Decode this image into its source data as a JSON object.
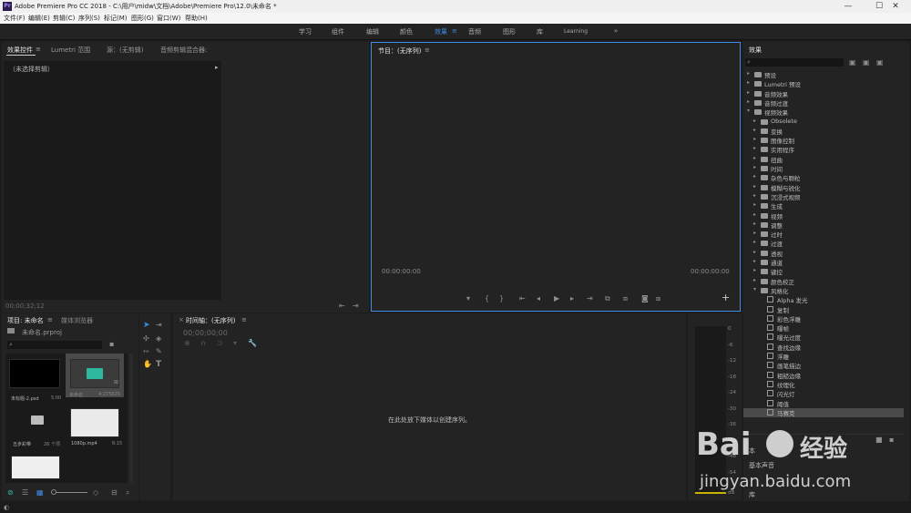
{
  "title": {
    "text": "Adobe Premiere Pro CC 2018 - C:\\用户\\midw\\文档\\Adobe\\Premiere Pro\\12.0\\未命名 *",
    "logo": "Pr",
    "minimize": "—",
    "maximize": "☐",
    "close": "✕"
  },
  "menu": [
    "文件(F)",
    "编辑(E)",
    "剪辑(C)",
    "序列(S)",
    "标记(M)",
    "图形(G)",
    "窗口(W)",
    "帮助(H)"
  ],
  "workspaces": {
    "items": [
      "学习",
      "组件",
      "编辑",
      "颜色",
      "效果",
      "音频",
      "图形",
      "库",
      "Learning"
    ],
    "active": "效果",
    "more": "»"
  },
  "source_panel": {
    "tabs": [
      "效果控件",
      "Lumetri 范围",
      "源：(无剪辑)",
      "音频剪辑混合器:"
    ],
    "no_clip": "（未选择剪辑）",
    "timecode": "00;00;32;12"
  },
  "program_panel": {
    "title": "节目：(无序列)",
    "timecode_left": "00:00:00:00",
    "timecode_right": "00:00:00:00"
  },
  "effects_panel": {
    "title": "效果",
    "tree": [
      {
        "label": "预设",
        "level": 0,
        "type": "folder",
        "expanded": false
      },
      {
        "label": "Lumetri 预设",
        "level": 0,
        "type": "folder",
        "expanded": false
      },
      {
        "label": "音频效果",
        "level": 0,
        "type": "folder",
        "expanded": false
      },
      {
        "label": "音频过渡",
        "level": 0,
        "type": "folder",
        "expanded": false
      },
      {
        "label": "视频效果",
        "level": 0,
        "type": "folder",
        "expanded": true
      },
      {
        "label": "Obsolete",
        "level": 1,
        "type": "folder",
        "expanded": false
      },
      {
        "label": "变换",
        "level": 1,
        "type": "folder",
        "expanded": false
      },
      {
        "label": "图像控制",
        "level": 1,
        "type": "folder",
        "expanded": false
      },
      {
        "label": "实用程序",
        "level": 1,
        "type": "folder",
        "expanded": false
      },
      {
        "label": "扭曲",
        "level": 1,
        "type": "folder",
        "expanded": false
      },
      {
        "label": "时间",
        "level": 1,
        "type": "folder",
        "expanded": false
      },
      {
        "label": "杂色与颗粒",
        "level": 1,
        "type": "folder",
        "expanded": false
      },
      {
        "label": "模糊与锐化",
        "level": 1,
        "type": "folder",
        "expanded": false
      },
      {
        "label": "沉浸式视频",
        "level": 1,
        "type": "folder",
        "expanded": false
      },
      {
        "label": "生成",
        "level": 1,
        "type": "folder",
        "expanded": false
      },
      {
        "label": "视频",
        "level": 1,
        "type": "folder",
        "expanded": false
      },
      {
        "label": "调整",
        "level": 1,
        "type": "folder",
        "expanded": false
      },
      {
        "label": "过时",
        "level": 1,
        "type": "folder",
        "expanded": false
      },
      {
        "label": "过渡",
        "level": 1,
        "type": "folder",
        "expanded": false
      },
      {
        "label": "透视",
        "level": 1,
        "type": "folder",
        "expanded": false
      },
      {
        "label": "通道",
        "level": 1,
        "type": "folder",
        "expanded": false
      },
      {
        "label": "键控",
        "level": 1,
        "type": "folder",
        "expanded": false
      },
      {
        "label": "颜色校正",
        "level": 1,
        "type": "folder",
        "expanded": false
      },
      {
        "label": "风格化",
        "level": 1,
        "type": "folder",
        "expanded": true
      },
      {
        "label": "Alpha 发光",
        "level": 2,
        "type": "effect"
      },
      {
        "label": "复制",
        "level": 2,
        "type": "effect"
      },
      {
        "label": "彩色浮雕",
        "level": 2,
        "type": "effect"
      },
      {
        "label": "曝帧",
        "level": 2,
        "type": "effect"
      },
      {
        "label": "曝光过度",
        "level": 2,
        "type": "effect"
      },
      {
        "label": "查找边缘",
        "level": 2,
        "type": "effect"
      },
      {
        "label": "浮雕",
        "level": 2,
        "type": "effect"
      },
      {
        "label": "画笔描边",
        "level": 2,
        "type": "effect"
      },
      {
        "label": "粗糙边缘",
        "level": 2,
        "type": "effect"
      },
      {
        "label": "纹理化",
        "level": 2,
        "type": "effect"
      },
      {
        "label": "闪光灯",
        "level": 2,
        "type": "effect"
      },
      {
        "label": "阈值",
        "level": 2,
        "type": "effect"
      },
      {
        "label": "马赛克",
        "level": 2,
        "type": "effect",
        "selected": true
      }
    ],
    "bottom_labels": [
      "本",
      "基本声音",
      "库"
    ]
  },
  "project_panel": {
    "tabs": [
      "项目: 未命名",
      "媒体浏览器"
    ],
    "project_file": "未命名.prproj",
    "items": [
      {
        "name": "未标题-2.psd",
        "meta": "5:00",
        "kind": "black"
      },
      {
        "name": "未命名",
        "meta": "4:275620",
        "kind": "audio"
      },
      {
        "name": "五步彩带",
        "meta": "26 个项",
        "kind": "bin"
      },
      {
        "name": "1080p.mp4",
        "meta": "6:15",
        "kind": "white"
      },
      {
        "name": "",
        "meta": "",
        "kind": "white"
      }
    ]
  },
  "timeline_panel": {
    "title": "时间轴：(无序列)",
    "timecode": "00;00;00;00",
    "drop_hint": "在此处放下媒体以创建序列。"
  },
  "audio_meter": {
    "scale": [
      "0",
      "-6",
      "-12",
      "-18",
      "-24",
      "-30",
      "-36",
      "-42",
      "-48",
      "-54"
    ],
    "unit": "dB"
  },
  "watermark": {
    "brand": "Bai",
    "brand2": "经验",
    "url": "jingyan.baidu.com"
  },
  "colors": {
    "accent": "#3e8ee8",
    "panel_bg": "#232323",
    "dark_bg": "#1a1a1a",
    "audio_clip": "#2fb8a0"
  }
}
